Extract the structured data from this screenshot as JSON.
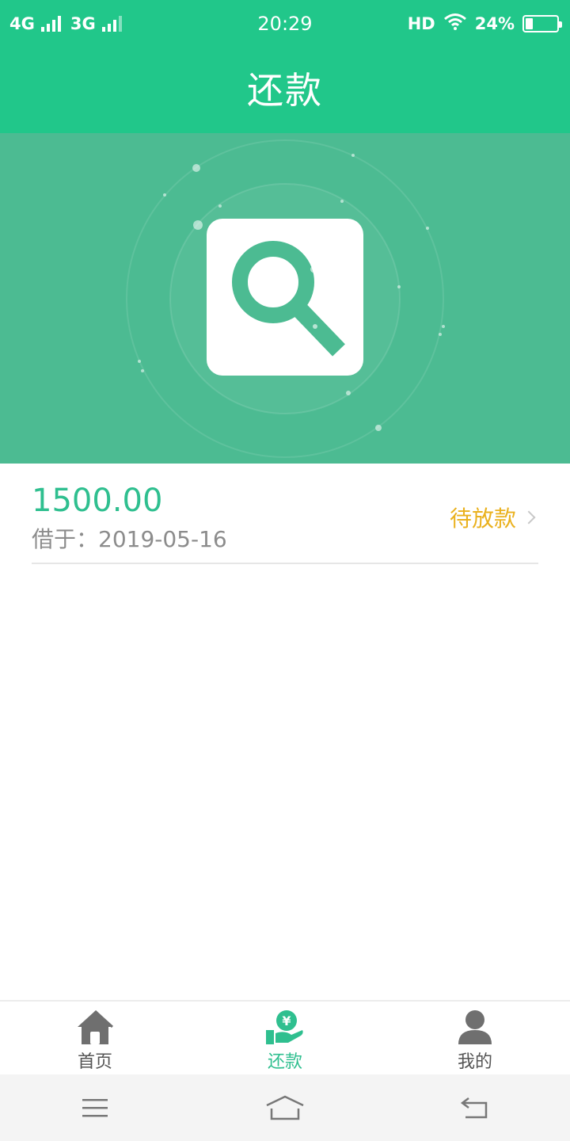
{
  "status_bar": {
    "network_1": "4G",
    "network_2": "3G",
    "time": "20:29",
    "hd": "HD",
    "battery_text": "24%",
    "battery_level": 0.24
  },
  "header": {
    "title": "还款"
  },
  "hero": {
    "icon": "search-icon"
  },
  "loan": {
    "amount": "1500.00",
    "borrowed_on": "借于：2019-05-16",
    "status": "待放款"
  },
  "tabs": [
    {
      "label": "首页",
      "icon": "home-icon",
      "active": false
    },
    {
      "label": "还款",
      "icon": "repay-icon",
      "active": true
    },
    {
      "label": "我的",
      "icon": "profile-icon",
      "active": false
    }
  ],
  "colors": {
    "brand": "#21c78a",
    "hero": "#4cbb92",
    "amount": "#2fbf8f",
    "status": "#eab11e"
  }
}
